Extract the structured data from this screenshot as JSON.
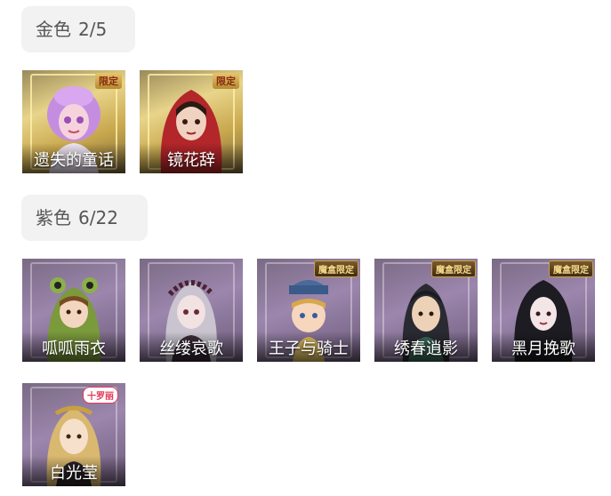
{
  "gold": {
    "title": "金色",
    "count": "2/5",
    "items": [
      {
        "name": "遗失的童话",
        "badge": "限定",
        "icon": "fairy-portrait-icon"
      },
      {
        "name": "镜花辞",
        "badge": "限定",
        "icon": "red-hood-portrait-icon"
      }
    ]
  },
  "purple": {
    "title": "紫色",
    "count": "6/22",
    "items": [
      {
        "name": "呱呱雨衣",
        "badge": "",
        "icon": "frog-raincoat-portrait-icon"
      },
      {
        "name": "丝缕哀歌",
        "badge": "",
        "icon": "silver-hair-portrait-icon"
      },
      {
        "name": "王子与骑士",
        "badge": "魔盒限定",
        "icon": "prince-knight-portrait-icon"
      },
      {
        "name": "绣春逍影",
        "badge": "魔盒限定",
        "icon": "swordsman-portrait-icon"
      },
      {
        "name": "黑月挽歌",
        "badge": "魔盒限定",
        "icon": "black-moon-portrait-icon"
      },
      {
        "name": "白光莹",
        "badge": "十罗丽",
        "icon": "white-light-portrait-icon"
      }
    ]
  },
  "colors": {
    "gold_accent": "#e8d48a",
    "purple_accent": "#9c86ad",
    "header_bg": "#f2f2f2",
    "header_text": "#555555"
  }
}
